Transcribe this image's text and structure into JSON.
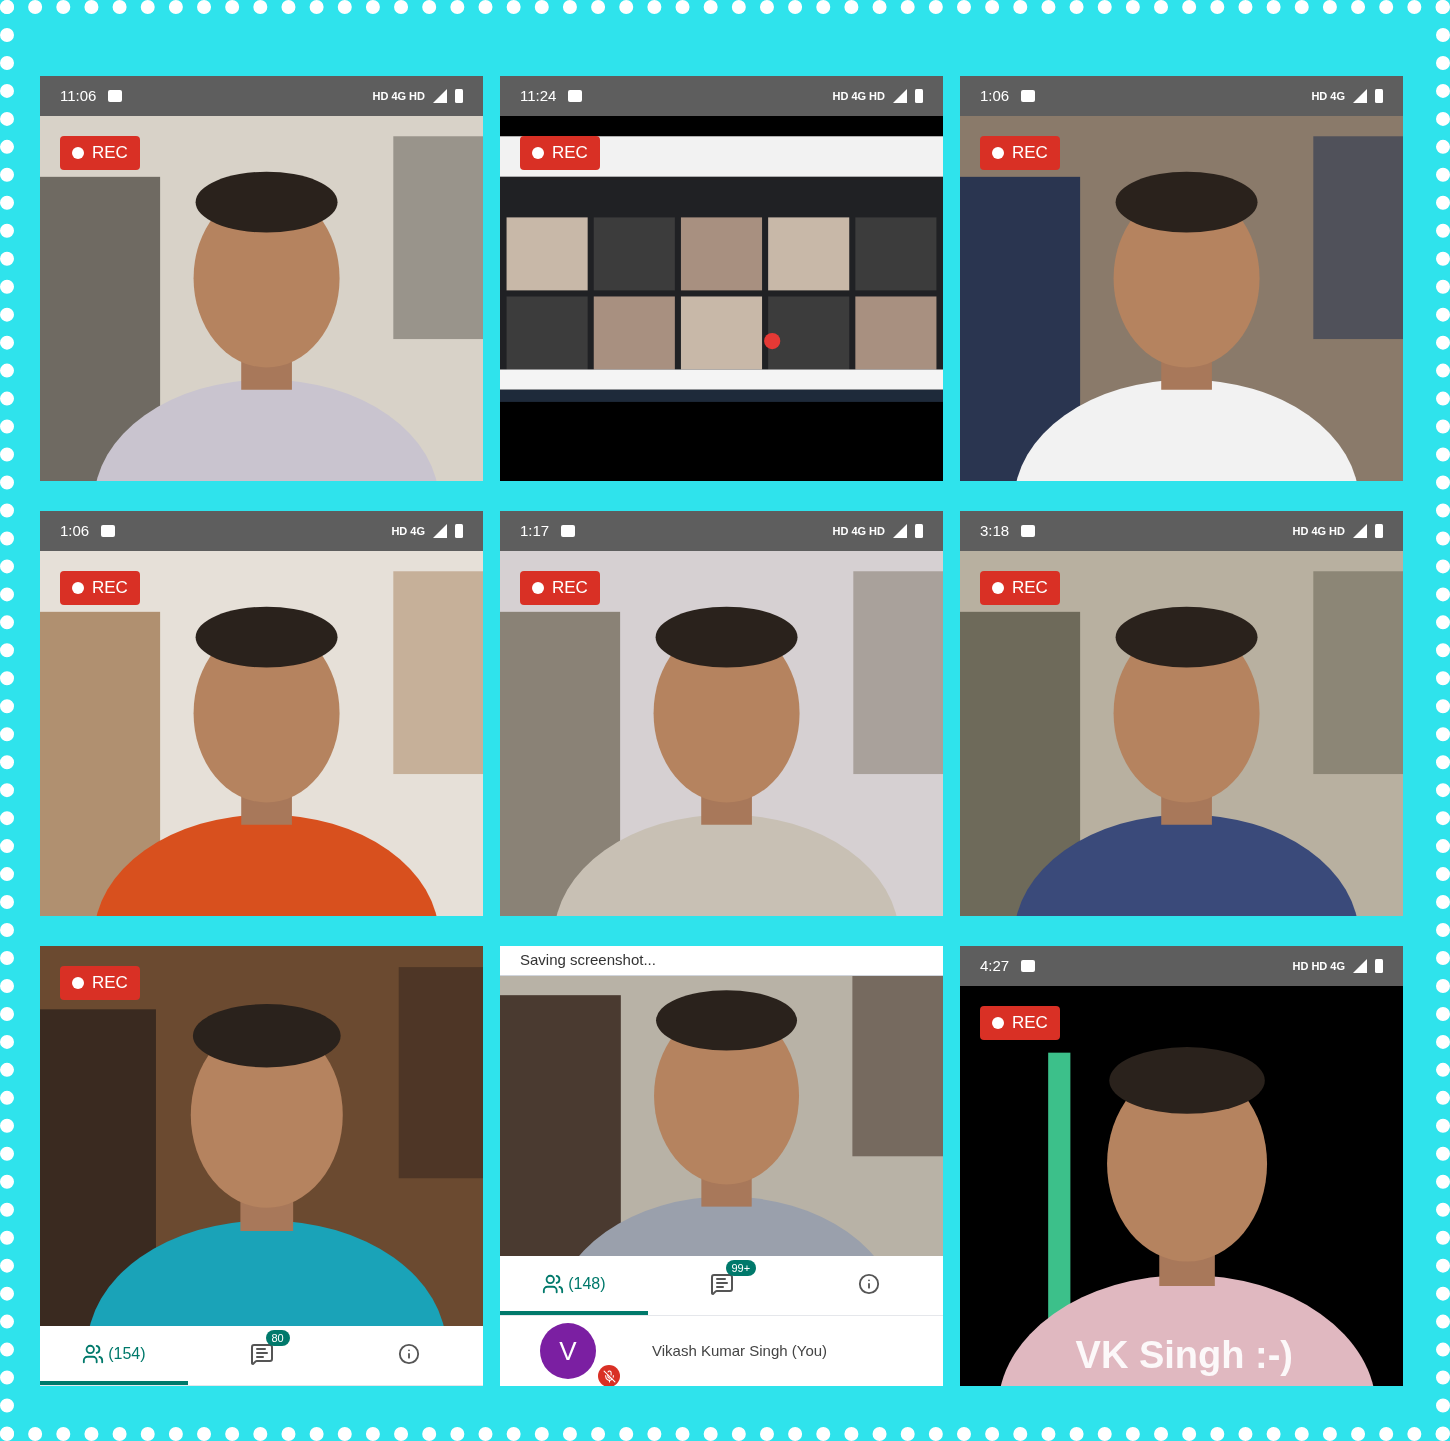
{
  "tiles": [
    {
      "status_bar": {
        "time": "11:06",
        "network": "HD 4G HD"
      },
      "rec_badge": "REC"
    },
    {
      "status_bar": {
        "time": "11:24",
        "network": "HD 4G HD"
      },
      "rec_badge": "REC"
    },
    {
      "status_bar": {
        "time": "1:06",
        "network": "HD 4G"
      },
      "rec_badge": "REC"
    },
    {
      "status_bar": {
        "time": "1:06",
        "network": "HD 4G"
      },
      "rec_badge": "REC"
    },
    {
      "status_bar": {
        "time": "1:17",
        "network": "HD 4G HD"
      },
      "rec_badge": "REC"
    },
    {
      "status_bar": {
        "time": "3:18",
        "network": "HD 4G HD"
      },
      "rec_badge": "REC"
    },
    {
      "rec_badge": "REC",
      "tabs": [
        {
          "kind": "people",
          "label": "(154)",
          "selected": true
        },
        {
          "kind": "chat",
          "badge": "80",
          "selected": false
        },
        {
          "kind": "info",
          "selected": false
        }
      ]
    },
    {
      "toast": "Saving screenshot...",
      "tabs": [
        {
          "kind": "people",
          "label": "(148)",
          "selected": true
        },
        {
          "kind": "chat",
          "badge": "99+",
          "selected": false
        },
        {
          "kind": "info",
          "selected": false
        }
      ],
      "participant": {
        "avatar": "V",
        "name": "Vikash Kumar Singh (You)"
      }
    },
    {
      "status_bar": {
        "time": "4:27",
        "network": "HD HD 4G"
      },
      "rec_badge": "REC",
      "caption": "VK Singh :-)"
    }
  ]
}
